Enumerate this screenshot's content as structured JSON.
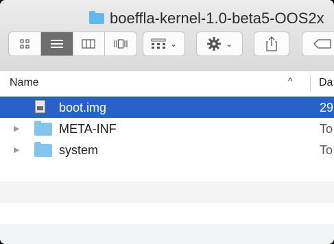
{
  "window": {
    "title": "boeffla-kernel-1.0-beta5-OOS2x"
  },
  "toolbar": {
    "view_buttons": [
      "icon-view",
      "list-view",
      "column-view",
      "cover-flow-view"
    ],
    "active_view": "list-view",
    "arrange_icon": "arrange-grid-icon",
    "action_icon": "gear-icon",
    "share_icon": "share-icon",
    "tag_icon": "tag-icon",
    "chevron": "⌄"
  },
  "columns": {
    "name": "Name",
    "date": "Da",
    "sort_indicator": "^"
  },
  "files": [
    {
      "name": "boot.img",
      "date": "29",
      "kind": "file",
      "selected": true
    },
    {
      "name": "META-INF",
      "date": "To",
      "kind": "folder",
      "selected": false
    },
    {
      "name": "system",
      "date": "To",
      "kind": "folder",
      "selected": false
    }
  ],
  "colors": {
    "selection": "#2962c6",
    "folder": "#84c5ee",
    "titlebar": "#e3e3e3"
  }
}
